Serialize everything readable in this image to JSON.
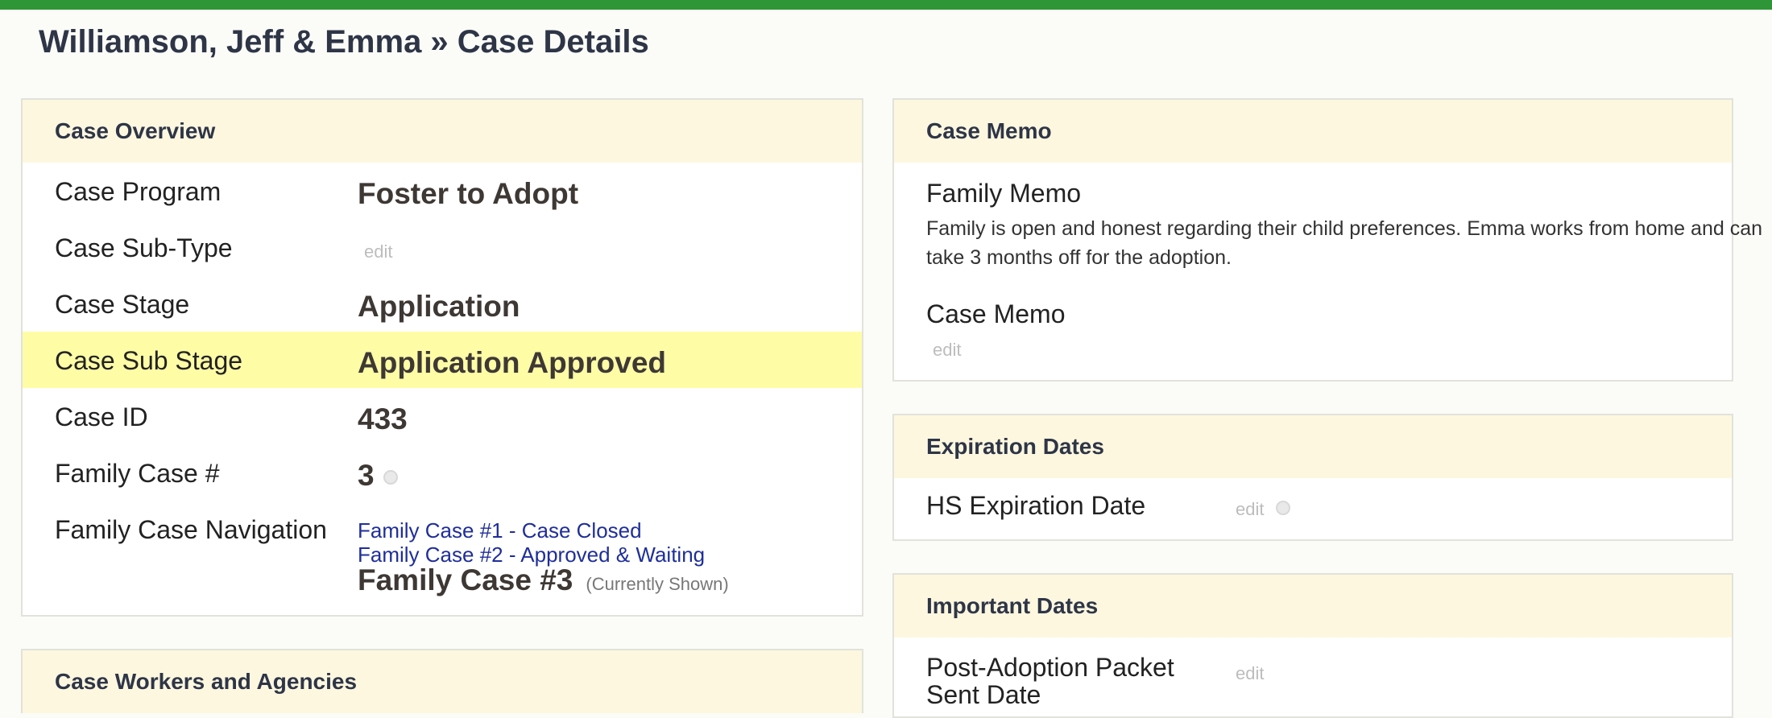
{
  "page": {
    "title": "Williamson, Jeff & Emma » Case Details"
  },
  "colors": {
    "top_bar": "#2e9636",
    "panel_header": "#fdf7df",
    "highlight_row": "#fffca6",
    "link": "#1f2e9a"
  },
  "case_overview": {
    "header": "Case Overview",
    "rows": [
      {
        "label": "Case Program",
        "value": "Foster to Adopt"
      },
      {
        "label": "Case Sub-Type",
        "value": "",
        "edit": "edit"
      },
      {
        "label": "Case Stage",
        "value": "Application"
      },
      {
        "label": "Case Sub Stage",
        "value": "Application Approved"
      },
      {
        "label": "Case ID",
        "value": "433"
      },
      {
        "label": "Family Case #",
        "value": "3",
        "icon": "info-dot-icon"
      },
      {
        "label": "Family Case Navigation"
      }
    ],
    "navigation": {
      "links": [
        "Family Case #1 - Case Closed",
        "Family Case #2 - Approved & Waiting"
      ],
      "current": "Family Case #3",
      "current_note": "(Currently Shown)"
    }
  },
  "case_workers": {
    "header": "Case Workers and Agencies"
  },
  "case_memo": {
    "header": "Case Memo",
    "family_memo_title": "Family Memo",
    "family_memo_text": "Family is open and honest regarding their child preferences. Emma works from home and can take 3 months off for the adoption.",
    "case_memo_title": "Case Memo",
    "case_memo_edit": "edit"
  },
  "expiration_dates": {
    "header": "Expiration Dates",
    "hs_label": "HS Expiration Date",
    "hs_edit": "edit",
    "hs_icon": "info-dot-icon"
  },
  "important_dates": {
    "header": "Important Dates",
    "post_adoption_label": "Post-Adoption Packet Sent Date",
    "post_adoption_edit": "edit"
  }
}
